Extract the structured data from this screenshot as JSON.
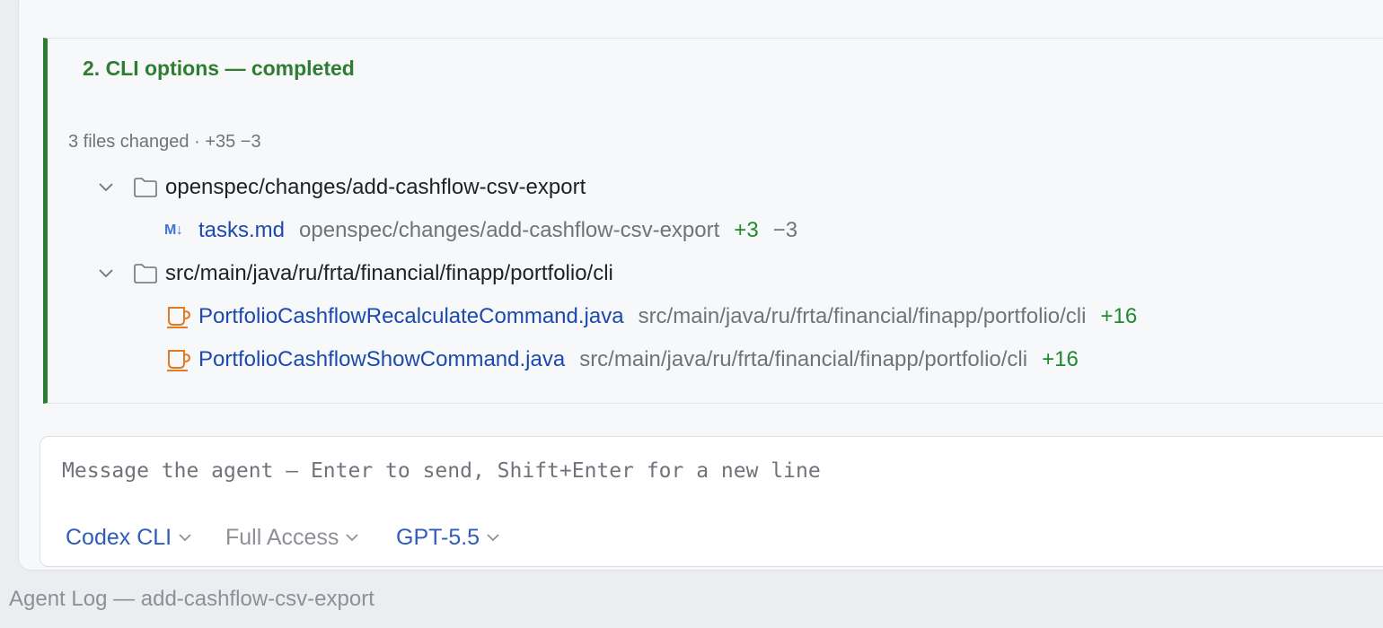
{
  "step": {
    "title": "2. CLI options — completed",
    "summary": "3 files changed · +35 −3",
    "accent_color": "#2e7d32"
  },
  "tree": {
    "folders": [
      {
        "name": "openspec/changes/add-cashflow-csv-export",
        "files": [
          {
            "icon": "markdown-icon",
            "icon_text": "M↓",
            "name": "tasks.md",
            "path": "openspec/changes/add-cashflow-csv-export",
            "added": "+3",
            "removed": "−3"
          }
        ]
      },
      {
        "name": "src/main/java/ru/frta/financial/finapp/portfolio/cli",
        "files": [
          {
            "icon": "java-icon",
            "name": "PortfolioCashflowRecalculateCommand.java",
            "path": "src/main/java/ru/frta/financial/finapp/portfolio/cli",
            "added": "+16"
          },
          {
            "icon": "java-icon",
            "name": "PortfolioCashflowShowCommand.java",
            "path": "src/main/java/ru/frta/financial/finapp/portfolio/cli",
            "added": "+16"
          }
        ]
      }
    ]
  },
  "composer": {
    "placeholder": "Message the agent — Enter to send, Shift+Enter for a new line",
    "agent": "Codex CLI",
    "access": "Full Access",
    "model": "GPT-5.5"
  },
  "footer": {
    "title": "Agent Log — add-cashflow-csv-export"
  }
}
